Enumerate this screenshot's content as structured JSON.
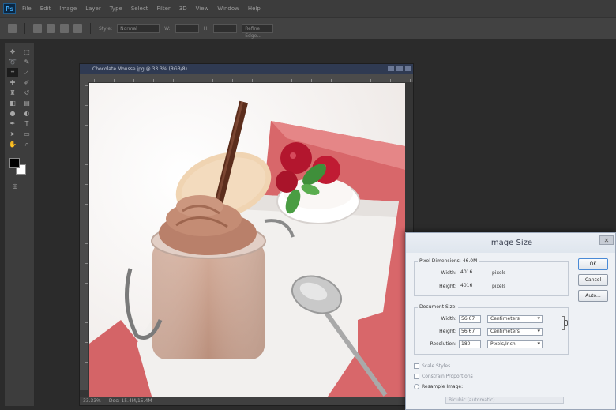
{
  "app": {
    "logo": "Ps"
  },
  "menu": [
    "File",
    "Edit",
    "Image",
    "Layer",
    "Type",
    "Select",
    "Filter",
    "3D",
    "View",
    "Window",
    "Help"
  ],
  "options": {
    "style_label": "Style:",
    "style_value": "Normal",
    "width_label": "W:",
    "height_label": "H:",
    "refine_label": "Refine Edge..."
  },
  "document": {
    "title": "Chocolate Mousse.jpg @ 33.3% (RGB/8)",
    "status_zoom": "33.33%",
    "status_info": "Doc: 15.4M/15.4M"
  },
  "dialog": {
    "title": "Image Size",
    "close": "✕",
    "pixel_dimensions": {
      "legend": "Pixel Dimensions: 46.0M",
      "width_label": "Width:",
      "width_value": "4016",
      "width_unit": "pixels",
      "height_label": "Height:",
      "height_value": "4016",
      "height_unit": "pixels"
    },
    "document_size": {
      "legend": "Document Size:",
      "width_label": "Width:",
      "width_value": "56.67",
      "width_unit": "Centimeters",
      "height_label": "Height:",
      "height_value": "56.67",
      "height_unit": "Centimeters",
      "resolution_label": "Resolution:",
      "resolution_value": "180",
      "resolution_unit": "Pixels/Inch"
    },
    "buttons": {
      "ok": "OK",
      "cancel": "Cancel",
      "auto": "Auto..."
    },
    "checkboxes": {
      "scale_styles": "Scale Styles",
      "constrain": "Constrain Proportions",
      "resample": "Resample Image:"
    },
    "resample_method": "Bicubic (automatic)"
  },
  "colors": {
    "foreground": "#000000",
    "background": "#ffffff"
  }
}
